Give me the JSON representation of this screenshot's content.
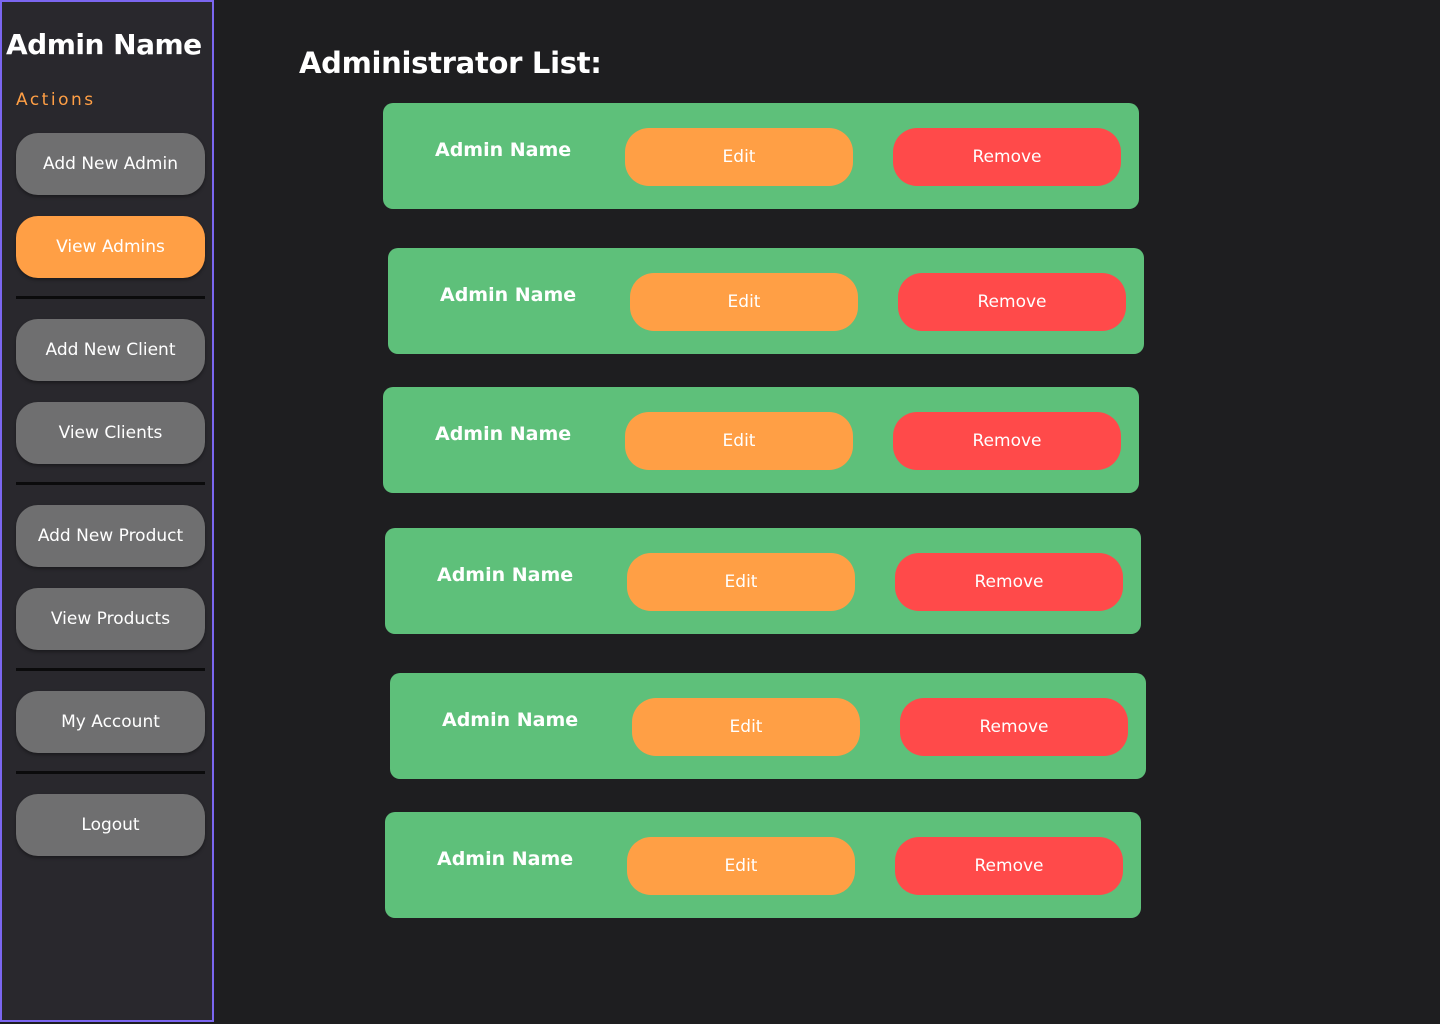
{
  "sidebar": {
    "admin_name": "Admin Name",
    "actions_label": "Actions",
    "buttons": [
      {
        "label": "Add New Admin"
      },
      {
        "label": "View Admins"
      },
      {
        "label": "Add New Client"
      },
      {
        "label": "View Clients"
      },
      {
        "label": "Add New Product"
      },
      {
        "label": "View Products"
      },
      {
        "label": "My Account"
      },
      {
        "label": "Logout"
      }
    ],
    "active_button": "View Admins"
  },
  "main": {
    "title": "Administrator List:",
    "admins": [
      {
        "name": "Admin Name",
        "edit_label": "Edit",
        "remove_label": "Remove"
      },
      {
        "name": "Admin Name",
        "edit_label": "Edit",
        "remove_label": "Remove"
      },
      {
        "name": "Admin Name",
        "edit_label": "Edit",
        "remove_label": "Remove"
      },
      {
        "name": "Admin Name",
        "edit_label": "Edit",
        "remove_label": "Remove"
      },
      {
        "name": "Admin Name",
        "edit_label": "Edit",
        "remove_label": "Remove"
      },
      {
        "name": "Admin Name",
        "edit_label": "Edit",
        "remove_label": "Remove"
      }
    ]
  },
  "colors": {
    "background": "#1e1e20",
    "sidebar": "#29282d",
    "sidebar_border": "#7b66f0",
    "accent_orange": "#ff9f45",
    "button_gray": "#6f6f70",
    "card_green": "#5ec07a",
    "remove_red": "#ff4a4a"
  }
}
